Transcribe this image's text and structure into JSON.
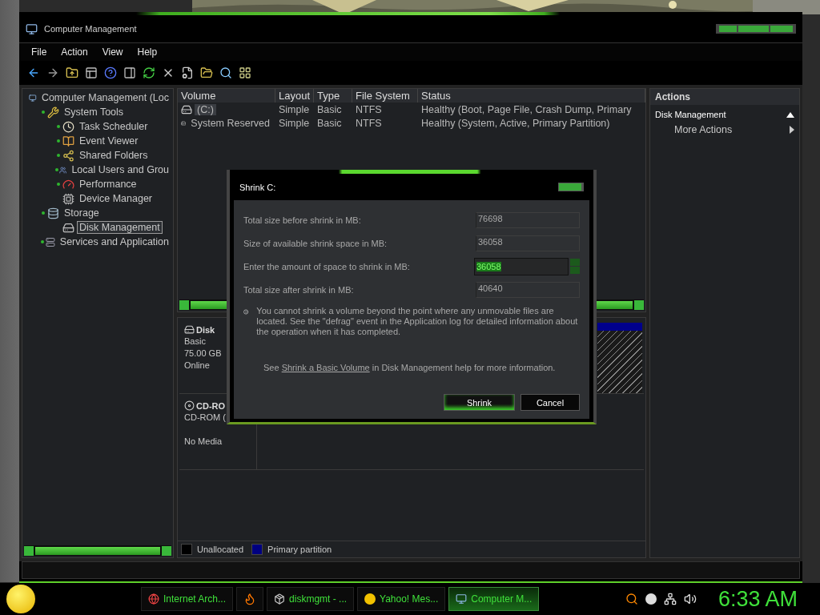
{
  "window": {
    "title": "Computer Management"
  },
  "menu": [
    "File",
    "Action",
    "View",
    "Help"
  ],
  "tree": [
    {
      "label": "Computer Management (Loc",
      "kind": "computer",
      "expandable": false,
      "selected": false,
      "children": [
        {
          "label": "System Tools",
          "kind": "tools",
          "expandable": true,
          "selected": false,
          "children": [
            {
              "label": "Task Scheduler",
              "kind": "clock",
              "expandable": true,
              "selected": false
            },
            {
              "label": "Event Viewer",
              "kind": "log",
              "expandable": true,
              "selected": false
            },
            {
              "label": "Shared Folders",
              "kind": "share",
              "expandable": true,
              "selected": false
            },
            {
              "label": "Local Users and Grou",
              "kind": "users",
              "expandable": true,
              "selected": false
            },
            {
              "label": "Performance",
              "kind": "gauge",
              "expandable": true,
              "selected": false
            },
            {
              "label": "Device Manager",
              "kind": "device",
              "expandable": false,
              "selected": false
            }
          ]
        },
        {
          "label": "Storage",
          "kind": "storage",
          "expandable": true,
          "selected": false,
          "children": [
            {
              "label": "Disk Management",
              "kind": "disk",
              "expandable": false,
              "selected": true
            }
          ]
        },
        {
          "label": "Services and Application",
          "kind": "services",
          "expandable": true,
          "selected": false
        }
      ]
    }
  ],
  "volumes": {
    "columns": [
      "Volume",
      "Layout",
      "Type",
      "File System",
      "Status"
    ],
    "rows": [
      {
        "cells": [
          "(C:)",
          "Simple",
          "Basic",
          "NTFS",
          "Healthy (Boot, Page File, Crash Dump, Primary"
        ],
        "selected": true
      },
      {
        "cells": [
          "System Reserved",
          "Simple",
          "Basic",
          "NTFS",
          "Healthy (System, Active, Primary Partition)"
        ],
        "selected": false
      }
    ]
  },
  "disks": [
    {
      "kind": "disk",
      "name": "Disk",
      "type": "Basic",
      "size": "75.00 GB",
      "status": "Online"
    },
    {
      "kind": "cdrom",
      "name": "CD-RO",
      "type": "CD-ROM (",
      "status": "No Media"
    }
  ],
  "legend": [
    {
      "label": "Unallocated",
      "color": "#000000"
    },
    {
      "label": "Primary partition",
      "color": "#000080"
    }
  ],
  "actions": {
    "title": "Actions",
    "section": "Disk Management",
    "items": [
      "More Actions"
    ]
  },
  "dialog": {
    "title": "Shrink C:",
    "fields": [
      {
        "label": "Total size before shrink in MB:",
        "value": "76698",
        "kind": "readonly"
      },
      {
        "label": "Size of available shrink space in MB:",
        "value": "36058",
        "kind": "readonly"
      },
      {
        "label": "Enter the amount of space to shrink in MB:",
        "value": "36058",
        "kind": "spin"
      },
      {
        "label": "Total size after shrink in MB:",
        "value": "40640",
        "kind": "readonly"
      }
    ],
    "info": "You cannot shrink a volume beyond the point where any unmovable files are located. See the \"defrag\" event in the Application log for detailed information about the operation when it has completed.",
    "help": {
      "before": "See ",
      "link": "Shrink a Basic Volume",
      "after": " in Disk Management help for more information."
    },
    "buttons": [
      {
        "label": "Shrink",
        "default": true
      },
      {
        "label": "Cancel",
        "default": false
      }
    ]
  },
  "taskbar": {
    "items": [
      {
        "kind": "chrome",
        "label": "Internet Arch...",
        "selected": false
      },
      {
        "kind": "firefox",
        "selected": false
      },
      {
        "kind": "app",
        "label": "diskmgmt - ...",
        "selected": false
      },
      {
        "kind": "messenger",
        "label": "Yahoo! Mes...",
        "selected": false
      },
      {
        "kind": "computer",
        "label": "Computer M...",
        "selected": true
      }
    ],
    "clock": "6:33 AM"
  }
}
